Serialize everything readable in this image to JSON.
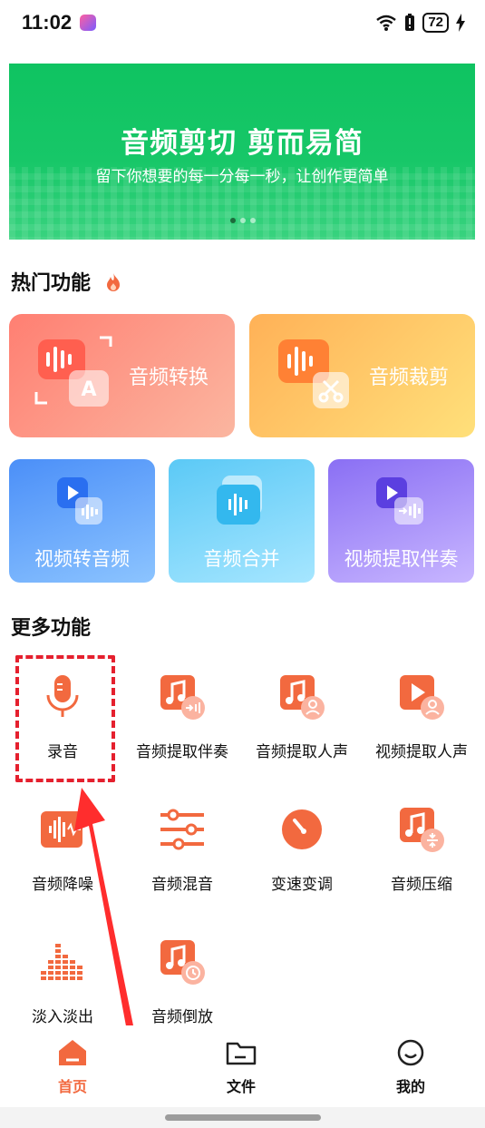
{
  "status": {
    "time": "11:02",
    "battery": "72"
  },
  "banner": {
    "title": "音频剪切 剪而易简",
    "subtitle": "留下你想要的每一分每一秒，让创作更简单"
  },
  "hot": {
    "title": "热门功能",
    "big": [
      {
        "label": "音频转换"
      },
      {
        "label": "音频裁剪"
      }
    ],
    "mid": [
      {
        "label": "视频转音频"
      },
      {
        "label": "音频合并"
      },
      {
        "label": "视频提取伴奏"
      }
    ]
  },
  "more": {
    "title": "更多功能",
    "items": [
      {
        "label": "录音"
      },
      {
        "label": "音频提取伴奏"
      },
      {
        "label": "音频提取人声"
      },
      {
        "label": "视频提取人声"
      },
      {
        "label": "音频降噪"
      },
      {
        "label": "音频混音"
      },
      {
        "label": "变速变调"
      },
      {
        "label": "音频压缩"
      },
      {
        "label": "淡入淡出"
      },
      {
        "label": "音频倒放"
      }
    ]
  },
  "tabs": [
    {
      "label": "首页"
    },
    {
      "label": "文件"
    },
    {
      "label": "我的"
    }
  ],
  "colors": {
    "accent": "#f2693f",
    "banner": "#17c768",
    "annotation": "#e5202e"
  }
}
